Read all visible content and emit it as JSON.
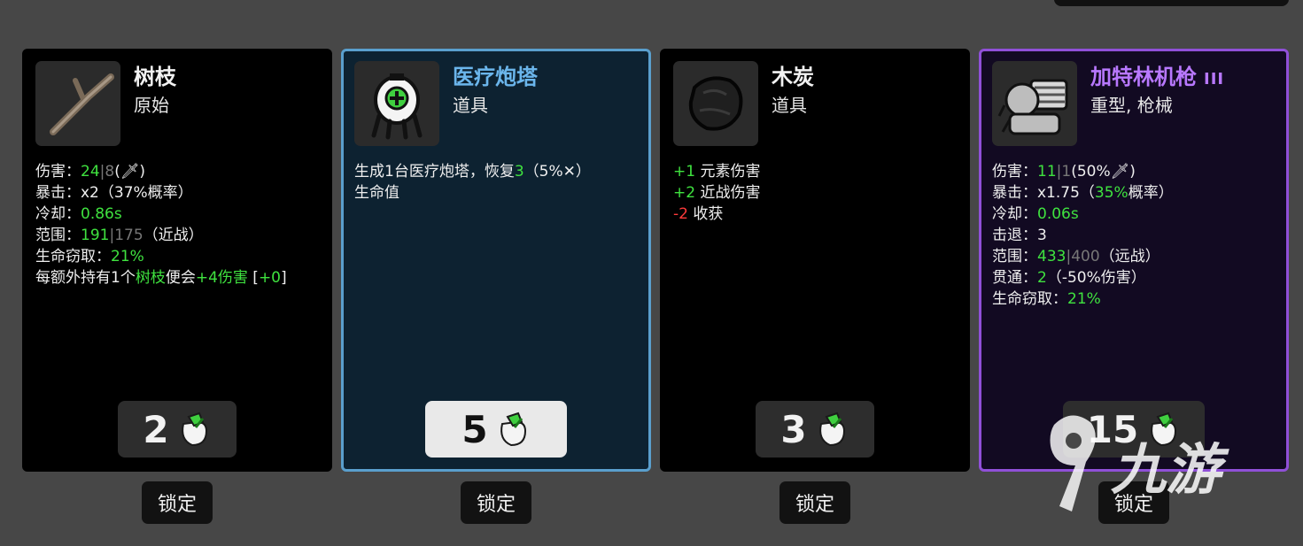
{
  "cards": [
    {
      "name": "树枝",
      "type": "原始",
      "icon": "stick-icon",
      "stats": [
        {
          "label": "伤害：",
          "value": "24",
          "sep": "|",
          "extra": "8",
          "tail": "(🗡)"
        },
        {
          "label": "暴击：",
          "value": "x2",
          "rest": "（37%概率）",
          "rest_pct": "37%"
        },
        {
          "label": "冷却：",
          "value": "0.86s"
        },
        {
          "label": "范围：",
          "value": "191",
          "sep": "|",
          "extra": "175",
          "tail": "（近战）"
        },
        {
          "label": "生命窃取：",
          "value": "21%"
        },
        {
          "text1": "每额外持有1个",
          "green1": "树枝",
          "text2": "便会",
          "green2": "+4伤害",
          "text3": "[",
          "green3": "+0",
          "text4": "]"
        }
      ],
      "price": "2",
      "lock_label": "锁定"
    },
    {
      "name": "医疗炮塔",
      "type": "道具",
      "icon": "medical-turret-icon",
      "desc_line1_a": "生成1台医疗炮塔，恢复",
      "desc_line1_b": "3",
      "desc_line1_c": "（5%✕）",
      "desc_line2": "生命值",
      "price": "5",
      "lock_label": "锁定"
    },
    {
      "name": "木炭",
      "type": "道具",
      "icon": "charcoal-icon",
      "effects": [
        {
          "amount": "+1",
          "label": "元素伤害",
          "color": "#3fe23f"
        },
        {
          "amount": "+2",
          "label": "近战伤害",
          "color": "#3fe23f"
        },
        {
          "amount": "-2",
          "label": "收获",
          "color": "#ff3a3a"
        }
      ],
      "price": "3",
      "lock_label": "锁定"
    },
    {
      "name": "加特林机枪",
      "tier": "III",
      "type": "重型, 枪械",
      "icon": "gatling-gun-icon",
      "stats": [
        {
          "label": "伤害：",
          "value": "11",
          "sep": "|",
          "extra": "1",
          "tail": "(50%🗡)"
        },
        {
          "label": "暴击：",
          "plain": "x1.75",
          "rest_a": "（",
          "rest_pct": "35%",
          "rest_b": "概率）"
        },
        {
          "label": "冷却：",
          "value": "0.06s"
        },
        {
          "label": "击退：",
          "plain": "3"
        },
        {
          "label": "范围：",
          "value": "433",
          "sep": "|",
          "extra": "400",
          "tail": "（远战）"
        },
        {
          "label": "贯通：",
          "value": "2",
          "tail": "（-50%伤害）"
        },
        {
          "label": "生命窃取：",
          "value": "21%"
        }
      ],
      "price": "15",
      "lock_label": "锁定"
    }
  ],
  "colors": {
    "background": "#474747",
    "positive": "#3fe23f",
    "negative": "#ff3a3a",
    "selected_border": "#5a9fcd",
    "rare_border": "#9050d8"
  },
  "currency_icon": "material-bag-icon",
  "watermark": "九游"
}
